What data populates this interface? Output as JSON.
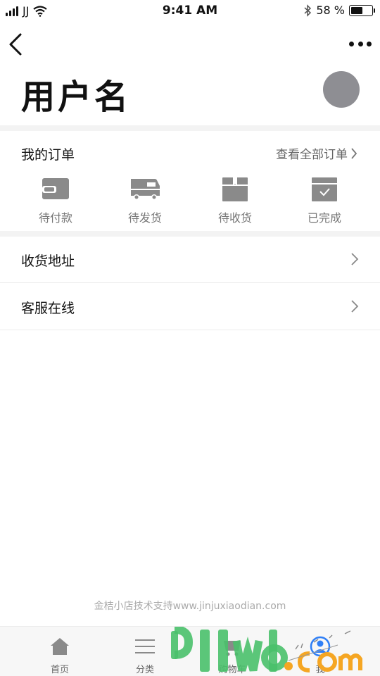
{
  "status_bar": {
    "carrier": "JJ",
    "time": "9:41 AM",
    "battery_percent": "58 %",
    "battery_level": 0.58,
    "icons": [
      "signal-icon",
      "wifi-icon",
      "bluetooth-icon",
      "battery-icon"
    ]
  },
  "header": {
    "username": "用户名"
  },
  "orders": {
    "title": "我的订单",
    "view_all": "查看全部订单",
    "items": [
      {
        "label": "待付款",
        "icon": "wallet-icon"
      },
      {
        "label": "待发货",
        "icon": "truck-icon"
      },
      {
        "label": "待收货",
        "icon": "package-icon"
      },
      {
        "label": "已完成",
        "icon": "check-box-icon"
      }
    ]
  },
  "menu": [
    {
      "label": "收货地址"
    },
    {
      "label": "客服在线"
    }
  ],
  "footer": {
    "powered_by": "金桔小店技术支持www.jinjuxiaodian.com"
  },
  "tab_bar": {
    "items": [
      {
        "label": "首页",
        "icon": "home-icon"
      },
      {
        "label": "分类",
        "icon": "menu-lines-icon"
      },
      {
        "label": "购物车",
        "icon": "cart-icon"
      },
      {
        "label": "我",
        "icon": "user-icon"
      }
    ],
    "active_color": "#2f7ff6"
  },
  "colors": {
    "icon_gray": "#8a8a8a",
    "divider": "#f3f3f3",
    "watermark_green": "#49c06a",
    "watermark_orange": "#f5a623"
  }
}
